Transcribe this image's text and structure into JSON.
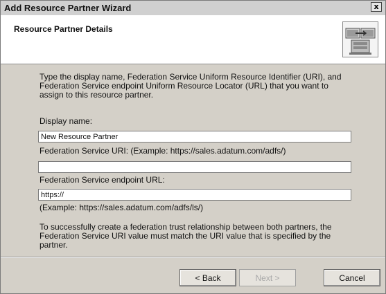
{
  "window": {
    "title": "Add Resource Partner Wizard",
    "close_label": "x"
  },
  "header": {
    "title": "Resource Partner Details",
    "icon": "partner-computers-icon"
  },
  "content": {
    "intro": "Type the display name, Federation Service Uniform Resource Identifier (URI), and Federation Service endpoint Uniform Resource Locator (URL) that you want to assign to this resource partner.",
    "display_name_label": "Display name:",
    "display_name_value": "New Resource Partner",
    "uri_label": "Federation Service URI: (Example: https://sales.adatum.com/adfs/)",
    "uri_value": "",
    "url_label": "Federation Service endpoint URL:",
    "url_value": "https://",
    "url_example": "(Example: https://sales.adatum.com/adfs/ls/)",
    "note": "To successfully create a federation trust relationship between both partners, the Federation Service URI value must match the URI value that is specified by the partner."
  },
  "buttons": {
    "back": "< Back",
    "next": "Next >",
    "cancel": "Cancel",
    "next_enabled": false
  }
}
